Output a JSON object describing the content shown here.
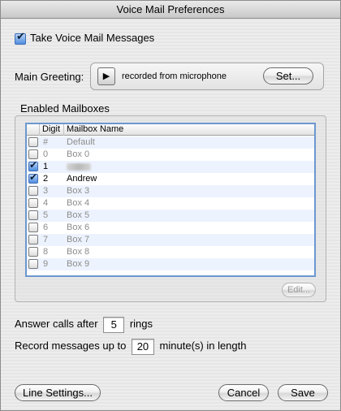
{
  "window": {
    "title": "Voice Mail Preferences"
  },
  "take_messages": {
    "label": "Take Voice Mail Messages",
    "checked": true
  },
  "greeting": {
    "label": "Main Greeting:",
    "play_icon": "play-icon",
    "source": "recorded from microphone",
    "set_label": "Set..."
  },
  "mailboxes": {
    "label": "Enabled Mailboxes",
    "columns": [
      "Digit",
      "Mailbox Name"
    ],
    "rows": [
      {
        "digit": "#",
        "name": "Default",
        "checked": false,
        "enabled": false
      },
      {
        "digit": "0",
        "name": "Box 0",
        "checked": false,
        "enabled": false
      },
      {
        "digit": "1",
        "name": "",
        "checked": true,
        "enabled": true
      },
      {
        "digit": "2",
        "name": "Andrew",
        "checked": true,
        "enabled": true
      },
      {
        "digit": "3",
        "name": "Box 3",
        "checked": false,
        "enabled": false
      },
      {
        "digit": "4",
        "name": "Box 4",
        "checked": false,
        "enabled": false
      },
      {
        "digit": "5",
        "name": "Box 5",
        "checked": false,
        "enabled": false
      },
      {
        "digit": "6",
        "name": "Box 6",
        "checked": false,
        "enabled": false
      },
      {
        "digit": "7",
        "name": "Box 7",
        "checked": false,
        "enabled": false
      },
      {
        "digit": "8",
        "name": "Box 8",
        "checked": false,
        "enabled": false
      },
      {
        "digit": "9",
        "name": "Box 9",
        "checked": false,
        "enabled": false
      }
    ],
    "edit_label": "Edit..."
  },
  "answer": {
    "prefix": "Answer calls after",
    "value": "5",
    "suffix": "rings"
  },
  "record": {
    "prefix": "Record messages up to",
    "value": "20",
    "suffix": "minute(s) in length"
  },
  "buttons": {
    "line_settings": "Line Settings...",
    "cancel": "Cancel",
    "save": "Save"
  }
}
